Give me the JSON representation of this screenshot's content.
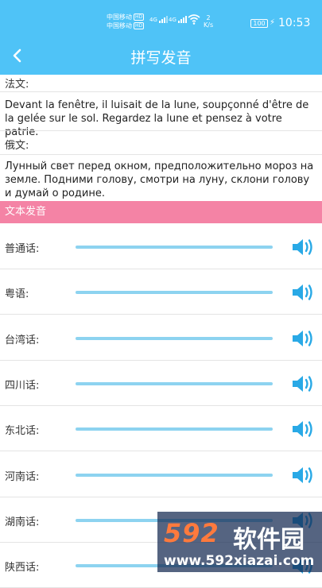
{
  "status_bar": {
    "carrier1": "中国移动",
    "carrier2": "中国移动",
    "hd": "HD",
    "net_type": "4G",
    "net_speed": "2",
    "net_unit": "K/s",
    "battery": "100",
    "time": "10:53"
  },
  "nav": {
    "title": "拼写发音"
  },
  "french": {
    "label": "法文:",
    "text": "Devant la fenêtre, il luisait de la lune, soupçonné d'être de la gelée sur le sol. Regardez la lune et pensez à votre patrie."
  },
  "russian": {
    "label": "俄文:",
    "text": "Лунный свет перед окном, предположительно мороз на земле. Подними голову, смотри на луну, склони голову и думай о родине."
  },
  "section_header": "文本发音",
  "dialects": [
    {
      "name": "普通话:"
    },
    {
      "name": "粤语:"
    },
    {
      "name": "台湾话:"
    },
    {
      "name": "四川话:"
    },
    {
      "name": "东北话:"
    },
    {
      "name": "河南话:"
    },
    {
      "name": "湖南话:"
    },
    {
      "name": "陕西话:"
    }
  ],
  "watermark": {
    "logo": "592",
    "name": "软件园",
    "url": "www.592xiazai.com"
  },
  "colors": {
    "accent": "#4fc3f7",
    "section": "#f483a5",
    "track": "#8dd3f0",
    "speaker": "#29a9e6"
  }
}
